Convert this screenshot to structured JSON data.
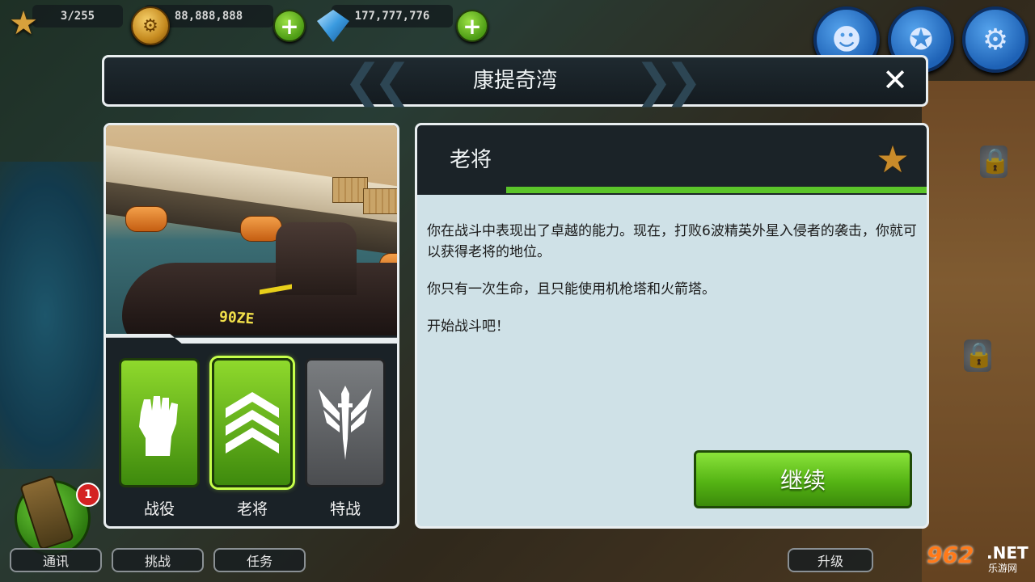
{
  "resources": {
    "stars": "3/255",
    "gold": "88,888,888",
    "gems": "177,777,776"
  },
  "dialog": {
    "title": "康提奇湾",
    "mode_title": "老将",
    "description": [
      "你在战斗中表现出了卓越的能力。现在，打败6波精英外星入侵者的袭击，你就可以获得老将的地位。",
      "你只有一次生命，且只能使用机枪塔和火箭塔。",
      "开始战斗吧！"
    ],
    "continue_label": "继续",
    "preview_marking": "90ZE"
  },
  "modes": [
    {
      "label": "战役",
      "icon": "fist-icon",
      "selected": false
    },
    {
      "label": "老将",
      "icon": "sergeant-chevron-icon",
      "selected": true
    },
    {
      "label": "特战",
      "icon": "winged-dagger-icon",
      "selected": false
    }
  ],
  "bottom_nav": {
    "comms": "通讯",
    "challenge": "挑战",
    "missions": "任务",
    "upgrade": "升级",
    "comms_badge": "1"
  },
  "watermark": {
    "number": "962",
    "suffix": ".NET",
    "site": "乐游网"
  },
  "colors": {
    "accent_green": "#55b414",
    "panel_dark": "#1b2328",
    "panel_light": "#cfe1e7",
    "button_blue": "#1e62b6"
  }
}
